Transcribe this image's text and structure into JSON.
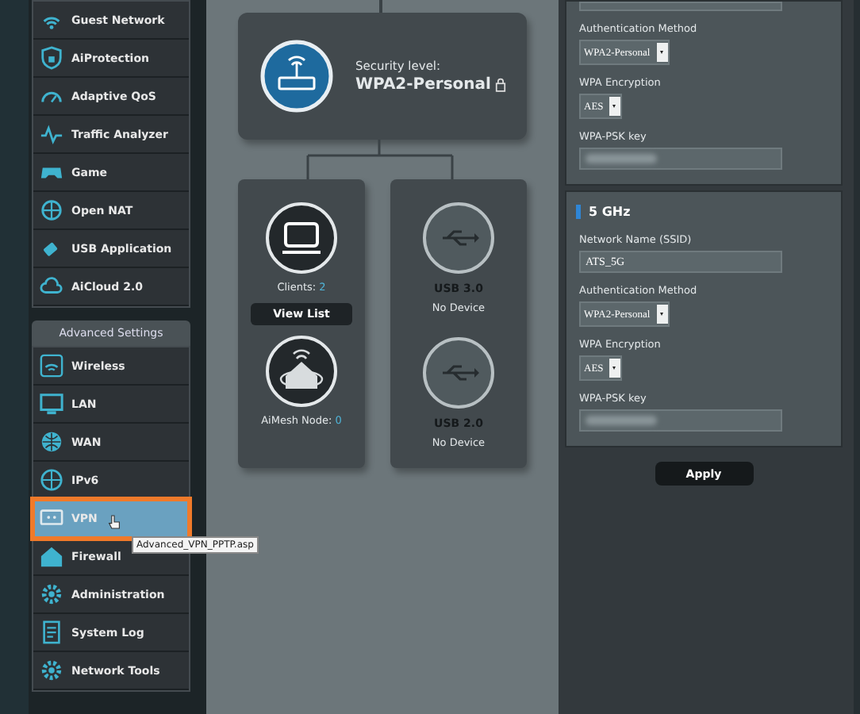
{
  "sidebar": {
    "general_items": [
      {
        "label": "Guest Network",
        "selected": false,
        "outlined": false
      },
      {
        "label": "AiProtection",
        "selected": false,
        "outlined": false
      },
      {
        "label": "Adaptive QoS",
        "selected": false,
        "outlined": false
      },
      {
        "label": "Traffic Analyzer",
        "selected": false,
        "outlined": false
      },
      {
        "label": "Game",
        "selected": false,
        "outlined": false
      },
      {
        "label": "Open NAT",
        "selected": false,
        "outlined": false
      },
      {
        "label": "USB Application",
        "selected": false,
        "outlined": false
      },
      {
        "label": "AiCloud 2.0",
        "selected": false,
        "outlined": false
      }
    ],
    "advanced_header": "Advanced Settings",
    "advanced_items": [
      {
        "label": "Wireless",
        "selected": false,
        "outlined": false
      },
      {
        "label": "LAN",
        "selected": false,
        "outlined": false
      },
      {
        "label": "WAN",
        "selected": false,
        "outlined": false
      },
      {
        "label": "IPv6",
        "selected": false,
        "outlined": false
      },
      {
        "label": "VPN",
        "selected": true,
        "outlined": true
      },
      {
        "label": "Firewall",
        "selected": false,
        "outlined": false
      },
      {
        "label": "Administration",
        "selected": false,
        "outlined": false
      },
      {
        "label": "System Log",
        "selected": false,
        "outlined": false
      },
      {
        "label": "Network Tools",
        "selected": false,
        "outlined": false
      }
    ]
  },
  "tooltip": "Advanced_VPN_PPTP.asp",
  "network_map": {
    "security": {
      "label": "Security level:",
      "value": "WPA2-Personal"
    },
    "clients": {
      "label": "Clients:",
      "count": "2",
      "button": "View List"
    },
    "aimesh": {
      "label": "AiMesh Node:",
      "count": "0"
    },
    "usb": [
      {
        "port": "USB 3.0",
        "status": "No Device"
      },
      {
        "port": "USB 2.0",
        "status": "No Device"
      }
    ]
  },
  "wireless_sections": [
    {
      "fields": [
        {
          "kind": "text"
        },
        {
          "kind": "select",
          "label": "Authentication Method",
          "value": "WPA2-Personal"
        },
        {
          "kind": "select",
          "label": "WPA Encryption",
          "value": "AES"
        },
        {
          "kind": "secret",
          "label": "WPA-PSK key"
        }
      ]
    },
    {
      "title": "5 GHz",
      "fields": [
        {
          "kind": "text",
          "label": "Network Name (SSID)",
          "value": "ATS_5G"
        },
        {
          "kind": "select",
          "label": "Authentication Method",
          "value": "WPA2-Personal"
        },
        {
          "kind": "select",
          "label": "WPA Encryption",
          "value": "AES"
        },
        {
          "kind": "secret",
          "label": "WPA-PSK key"
        }
      ]
    }
  ],
  "apply_button": "Apply"
}
